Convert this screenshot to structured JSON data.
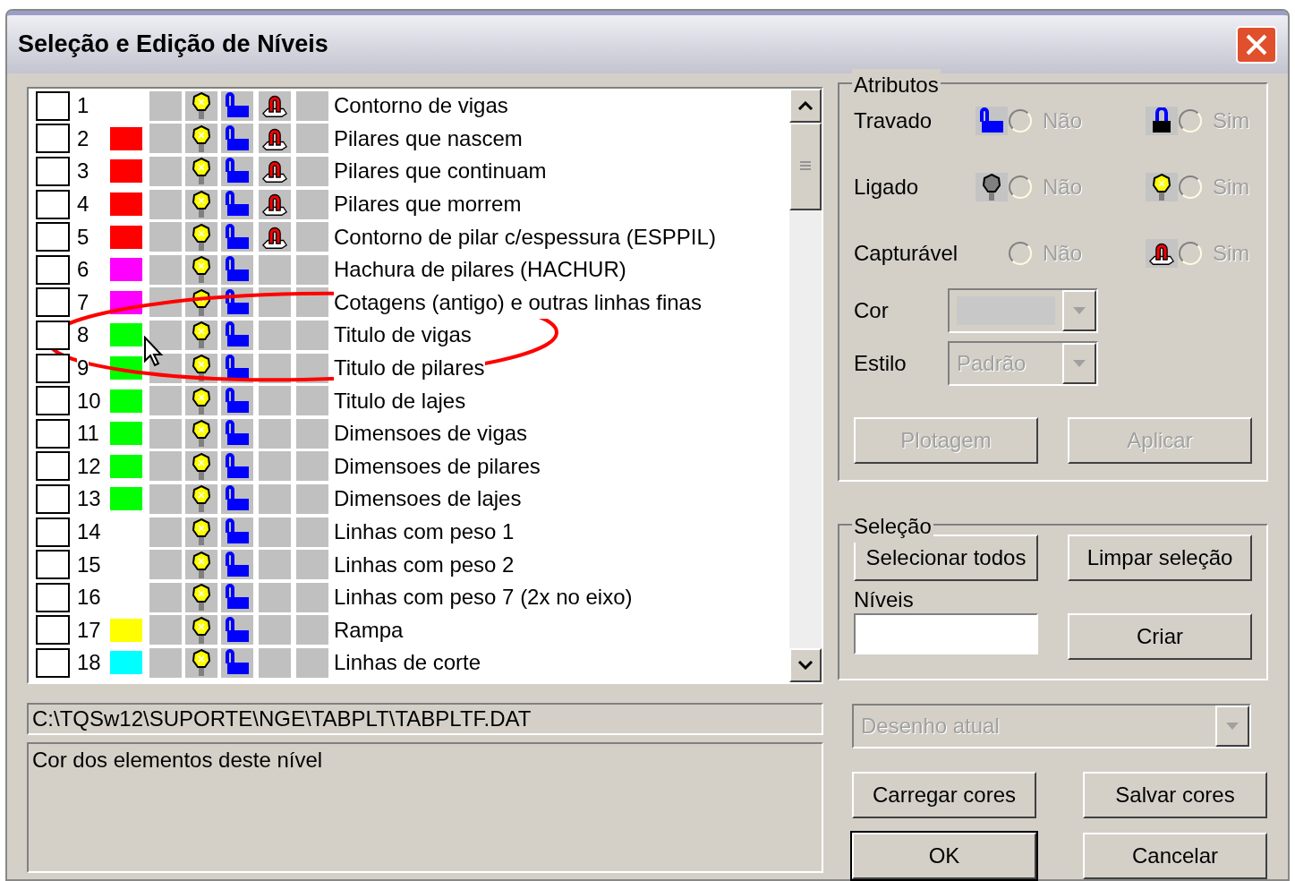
{
  "window": {
    "title": "Seleção e Edição de Níveis"
  },
  "levels": [
    {
      "checked": false,
      "number": "1",
      "on": true,
      "locked": false,
      "capturable": true,
      "name": "Contorno de vigas"
    },
    {
      "checked": false,
      "number": "2",
      "color": "#ff0000",
      "on": true,
      "locked": false,
      "capturable": true,
      "name": "Pilares que nascem"
    },
    {
      "checked": false,
      "number": "3",
      "color": "#ff0000",
      "on": true,
      "locked": false,
      "capturable": true,
      "name": "Pilares que continuam"
    },
    {
      "checked": false,
      "number": "4",
      "color": "#ff0000",
      "on": true,
      "locked": false,
      "capturable": true,
      "name": "Pilares que morrem"
    },
    {
      "checked": false,
      "number": "5",
      "color": "#ff0000",
      "on": true,
      "locked": false,
      "capturable": true,
      "name": "Contorno de pilar c/espessura (ESPPIL)"
    },
    {
      "checked": false,
      "number": "6",
      "color": "#ff00ff",
      "on": true,
      "locked": false,
      "capturable": false,
      "name": "Hachura de pilares (HACHUR)"
    },
    {
      "checked": false,
      "number": "7",
      "color": "#ff00ff",
      "on": true,
      "locked": false,
      "capturable": false,
      "name": "Cotagens (antigo) e outras linhas finas"
    },
    {
      "checked": false,
      "number": "8",
      "color": "#00ff00",
      "on": true,
      "locked": false,
      "capturable": false,
      "name": "Titulo de vigas"
    },
    {
      "checked": false,
      "number": "9",
      "color": "#00ff00",
      "on": true,
      "locked": false,
      "capturable": false,
      "name": "Titulo de pilares"
    },
    {
      "checked": false,
      "number": "10",
      "color": "#00ff00",
      "on": true,
      "locked": false,
      "capturable": false,
      "name": "Titulo de lajes"
    },
    {
      "checked": false,
      "number": "11",
      "color": "#00ff00",
      "on": true,
      "locked": false,
      "capturable": false,
      "name": "Dimensoes de vigas"
    },
    {
      "checked": false,
      "number": "12",
      "color": "#00ff00",
      "on": true,
      "locked": false,
      "capturable": false,
      "name": "Dimensoes de pilares"
    },
    {
      "checked": false,
      "number": "13",
      "color": "#00ff00",
      "on": true,
      "locked": false,
      "capturable": false,
      "name": "Dimensoes de lajes"
    },
    {
      "checked": false,
      "number": "14",
      "on": true,
      "locked": false,
      "capturable": false,
      "name": "Linhas com peso 1"
    },
    {
      "checked": false,
      "number": "15",
      "on": true,
      "locked": false,
      "capturable": false,
      "name": "Linhas com peso 2"
    },
    {
      "checked": false,
      "number": "16",
      "on": true,
      "locked": false,
      "capturable": false,
      "name": "Linhas com peso 7 (2x no eixo)"
    },
    {
      "checked": false,
      "number": "17",
      "color": "#ffff00",
      "on": true,
      "locked": false,
      "capturable": false,
      "name": "Rampa"
    },
    {
      "checked": false,
      "number": "18",
      "color": "#00ffff",
      "on": true,
      "locked": false,
      "capturable": false,
      "name": "Linhas de corte"
    }
  ],
  "file_path": "C:\\TQSw12\\SUPORTE\\NGE\\TABPLT\\TABPLTF.DAT",
  "description": "Cor dos elementos deste nível",
  "attributes": {
    "title": "Atributos",
    "rows": [
      {
        "label": "Travado",
        "options": [
          {
            "kind": "unlocked",
            "label": "Não",
            "selected": false,
            "disabled": true
          },
          {
            "kind": "locked",
            "label": "Sim",
            "selected": false,
            "disabled": true
          }
        ]
      },
      {
        "label": "Ligado",
        "options": [
          {
            "kind": "off",
            "label": "Não",
            "selected": false,
            "disabled": true
          },
          {
            "kind": "on",
            "label": "Sim",
            "selected": false,
            "disabled": true
          }
        ]
      },
      {
        "label": "Capturável",
        "options": [
          {
            "kind": "plain",
            "label": "Não",
            "selected": false,
            "disabled": true
          },
          {
            "kind": "capturable",
            "label": "Sim",
            "selected": false,
            "disabled": true
          }
        ]
      }
    ],
    "color_field": {
      "label": "Cor",
      "disabled": true
    },
    "style_field": {
      "label": "Estilo",
      "value": "Padrão",
      "disabled": true
    },
    "buttons": [
      {
        "label": "Plotagem",
        "disabled": true
      },
      {
        "label": "Aplicar",
        "disabled": true
      }
    ]
  },
  "selection": {
    "title": "Seleção",
    "buttons": [
      {
        "label": "Selecionar todos",
        "disabled": false
      },
      {
        "label": "Limpar seleção",
        "disabled": false
      }
    ],
    "levels_label": "Níveis",
    "create_button": {
      "label": "Criar",
      "disabled": false
    }
  },
  "drawing_select": {
    "value": "Desenho atual",
    "disabled": true
  },
  "buttons": [
    {
      "label": "Carregar cores",
      "default": false
    },
    {
      "label": "Salvar cores",
      "default": false
    },
    {
      "label": "OK",
      "default": true
    },
    {
      "label": "Cancelar",
      "default": false
    }
  ]
}
